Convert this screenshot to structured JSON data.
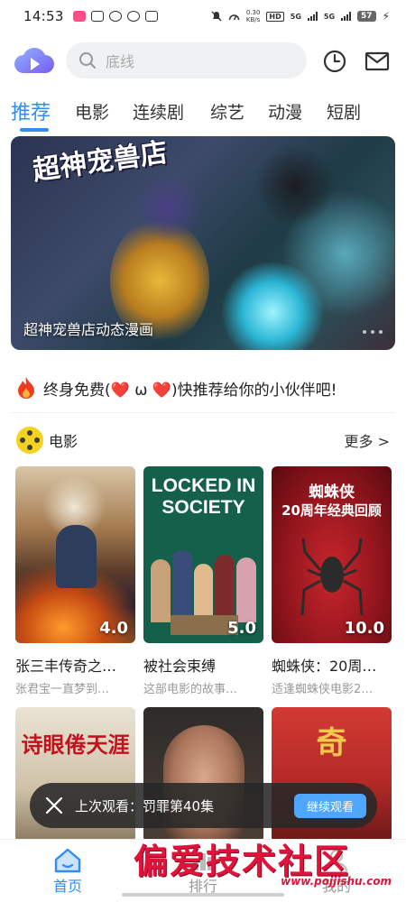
{
  "status_bar": {
    "time": "14:53",
    "speed_top": "0.30",
    "speed_bottom": "KB/s",
    "hd_label": "HD",
    "net1": "5G",
    "net2": "5G",
    "battery": "57"
  },
  "search": {
    "placeholder": "底线"
  },
  "tabs": [
    {
      "label": "推荐"
    },
    {
      "label": "电影"
    },
    {
      "label": "连续剧"
    },
    {
      "label": "综艺"
    },
    {
      "label": "动漫"
    },
    {
      "label": "短剧"
    }
  ],
  "banner": {
    "logo_text": "超神宠兽店",
    "title": "超神宠兽店动态漫画"
  },
  "promo": {
    "text": "终身免费(❤️ ω ❤️)快推荐给你的小伙伴吧!"
  },
  "section": {
    "title": "电影",
    "more": "更多 >"
  },
  "cards": [
    {
      "title": "张三丰传奇之…",
      "desc": "张君宝一直梦到…",
      "score": "4.0"
    },
    {
      "title": "被社会束缚",
      "desc": "这部电影的故事…",
      "score": "5.0",
      "poster_text": "LOCKED IN SOCIETY"
    },
    {
      "title": "蜘蛛侠：20周…",
      "desc": "适逢蜘蛛侠电影2…",
      "score": "10.0",
      "poster_text": "蜘蛛侠",
      "poster_sub": "20周年经典回顾"
    },
    {
      "poster_text": "诗眼倦天涯"
    },
    {},
    {
      "poster_text": "奇"
    }
  ],
  "toast": {
    "label": "上次观看：罚罪第40集",
    "button": "继续观看"
  },
  "bottom_nav": [
    {
      "label": "首页",
      "icon": "home-icon"
    },
    {
      "label": "排行",
      "icon": "ranking-icon"
    },
    {
      "label": "我的",
      "icon": "profile-icon"
    }
  ],
  "watermark": {
    "text": "偏爱技术社区",
    "url": "www.pojjishu.com"
  },
  "colors": {
    "accent": "#2f8df6",
    "watermark": "#e0143b"
  }
}
